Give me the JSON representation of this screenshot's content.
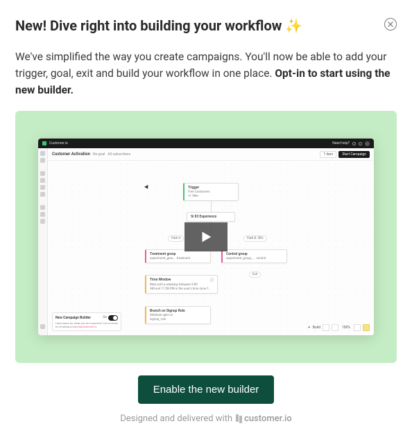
{
  "modal": {
    "title": "New! Dive right into building your workflow ✨",
    "body_lead": "We've simplified the way you create campaigns. You'll now be able to add your trigger, goal, exit and build your workflow in one place. ",
    "body_bold": "Opt-in to start using the new builder.",
    "cta_label": "Enable the new builder",
    "footer_prefix": "Designed and delivered with",
    "footer_brand": "customer.io"
  },
  "preview": {
    "topbar": {
      "product": "Customer.io",
      "need_help": "Need help?"
    },
    "header": {
      "title": "Customer Activation",
      "no_goal": "No goal",
      "subscribers": "All subscribers",
      "item_count": "1 item",
      "start_label": "Start Campaign"
    },
    "nodes": {
      "trigger": {
        "title": "Trigger",
        "segment": "Free Customers",
        "filter": "+1 filter"
      },
      "delay1": "Si 83 Experience",
      "path_a": "Path A",
      "path_b": "Path B: 50%",
      "treatment": {
        "title": "Treatment group",
        "exp": "experiment_grou…",
        "val": "treatment"
      },
      "control": {
        "title": "Control group",
        "exp": "experiment_group_…",
        "val": "control"
      },
      "exit": "Exit",
      "time_window": {
        "title": "Time Window",
        "line1": "Wait until a weekday between 9:00",
        "line2": "AM and 11:58 PM in the user's time zone f…"
      },
      "branch": {
        "title": "Branch on Signup Role",
        "sub": "Attribute split on",
        "attr": "signup_role"
      }
    },
    "bottom_panel": {
      "title": "New Campaign Builder",
      "toggle_on": "On",
      "desc_lead": "Have ideas for what can be improved? Let us know by emailing ",
      "desc_link": "product@customer.io"
    },
    "bottom_right": {
      "build": "Build",
      "zoom": "100%"
    }
  }
}
